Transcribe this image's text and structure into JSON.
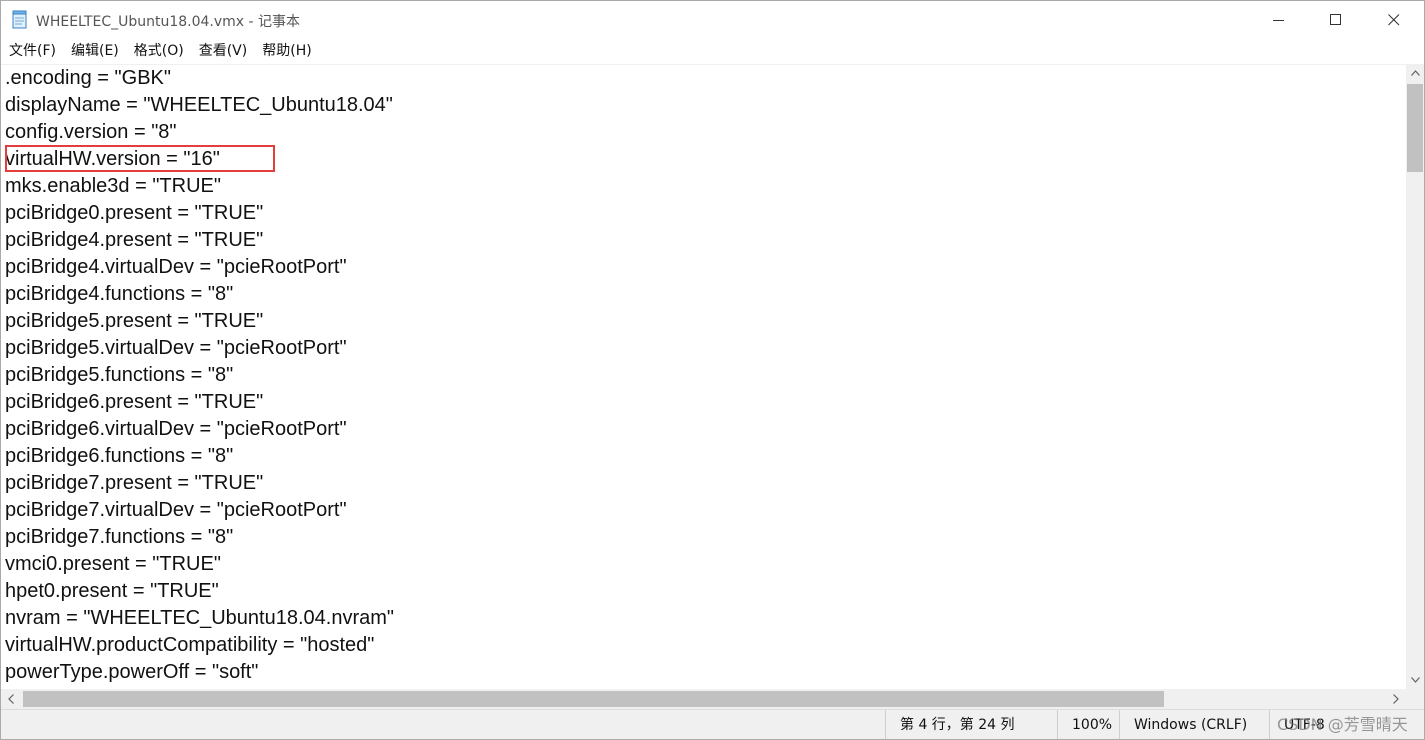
{
  "window": {
    "title": "WHEELTEC_Ubuntu18.04.vmx - 记事本",
    "app_icon": "notepad-icon"
  },
  "menu": {
    "items": [
      "文件(F)",
      "编辑(E)",
      "格式(O)",
      "查看(V)",
      "帮助(H)"
    ]
  },
  "editor": {
    "lines": [
      ".encoding = \"GBK\"",
      "displayName = \"WHEELTEC_Ubuntu18.04\"",
      "config.version = \"8\"",
      "virtualHW.version = \"16\"",
      "mks.enable3d = \"TRUE\"",
      "pciBridge0.present = \"TRUE\"",
      "pciBridge4.present = \"TRUE\"",
      "pciBridge4.virtualDev = \"pcieRootPort\"",
      "pciBridge4.functions = \"8\"",
      "pciBridge5.present = \"TRUE\"",
      "pciBridge5.virtualDev = \"pcieRootPort\"",
      "pciBridge5.functions = \"8\"",
      "pciBridge6.present = \"TRUE\"",
      "pciBridge6.virtualDev = \"pcieRootPort\"",
      "pciBridge6.functions = \"8\"",
      "pciBridge7.present = \"TRUE\"",
      "pciBridge7.virtualDev = \"pcieRootPort\"",
      "pciBridge7.functions = \"8\"",
      "vmci0.present = \"TRUE\"",
      "hpet0.present = \"TRUE\"",
      "nvram = \"WHEELTEC_Ubuntu18.04.nvram\"",
      "virtualHW.productCompatibility = \"hosted\"",
      "powerType.powerOff = \"soft\""
    ],
    "highlighted_line_index": 3,
    "highlight_color": "#e43d3d"
  },
  "statusbar": {
    "position": "第 4 行，第 24 列",
    "zoom": "100%",
    "line_ending": "Windows (CRLF)",
    "encoding": "UTF-8"
  },
  "watermark": "CSDN @芳雪晴天"
}
